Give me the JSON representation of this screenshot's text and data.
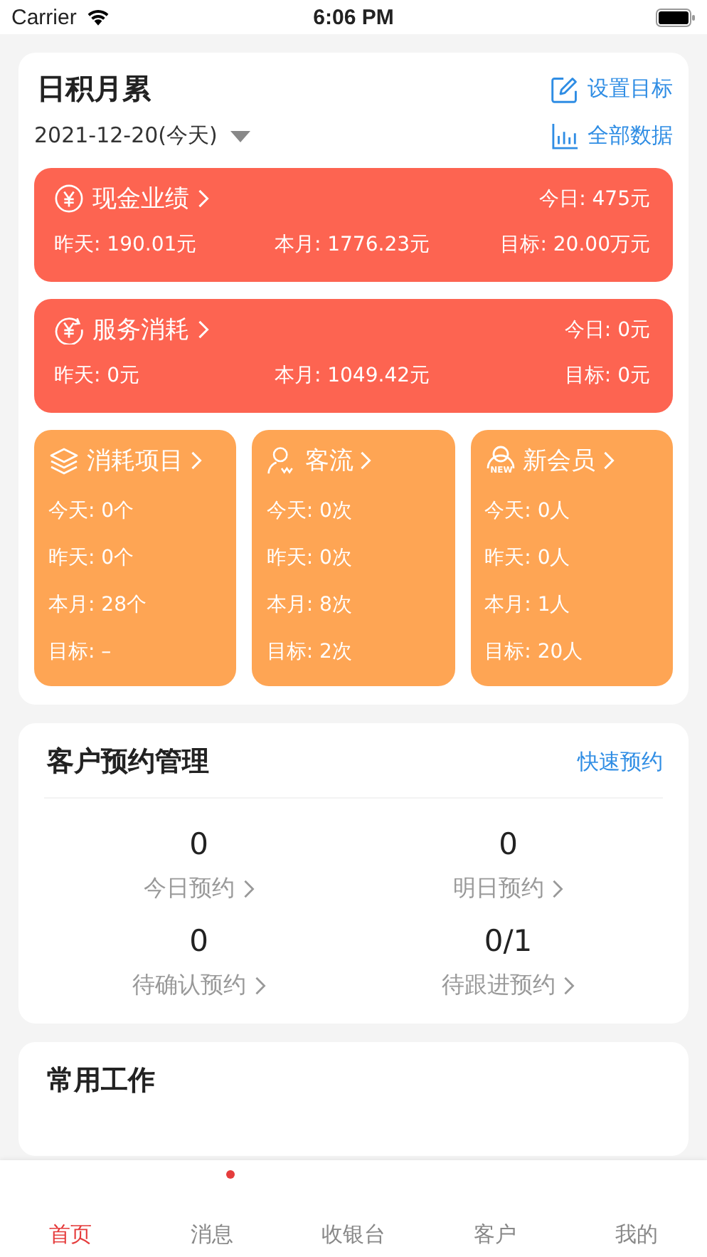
{
  "status_bar": {
    "carrier": "Carrier",
    "time": "6:06 PM"
  },
  "summary": {
    "title": "日积月累",
    "set_goal": "设置目标",
    "date": "2021-12-20(今天)",
    "all_data": "全部数据",
    "money_cards": [
      {
        "title": "现金业绩",
        "today": "今日: 475元",
        "yesterday": "昨天: 190.01元",
        "month": "本月: 1776.23元",
        "target": "目标: 20.00万元"
      },
      {
        "title": "服务消耗",
        "today": "今日: 0元",
        "yesterday": "昨天: 0元",
        "month": "本月: 1049.42元",
        "target": "目标: 0元"
      }
    ],
    "count_cards": [
      {
        "title": "消耗项目",
        "lines": [
          "今天: 0个",
          "昨天: 0个",
          "本月: 28个",
          "目标: –"
        ]
      },
      {
        "title": "客流",
        "lines": [
          "今天: 0次",
          "昨天: 0次",
          "本月: 8次",
          "目标: 2次"
        ]
      },
      {
        "badge_text": "NEW",
        "title": "新会员",
        "lines": [
          "今天: 0人",
          "昨天: 0人",
          "本月: 1人",
          "目标: 20人"
        ]
      }
    ]
  },
  "appointments": {
    "title": "客户预约管理",
    "quick_book": "快速预约",
    "stats": [
      {
        "value": "0",
        "label": "今日预约"
      },
      {
        "value": "0",
        "label": "明日预约"
      },
      {
        "value": "0",
        "label": "待确认预约"
      },
      {
        "value": "0/1",
        "label": "待跟进预约"
      }
    ]
  },
  "common_work": {
    "title": "常用工作"
  },
  "tab_bar": [
    {
      "label": "首页",
      "selected": true,
      "badge": false
    },
    {
      "label": "消息",
      "selected": false,
      "badge": true
    },
    {
      "label": "收银台",
      "selected": false,
      "badge": false
    },
    {
      "label": "客户",
      "selected": false,
      "badge": false
    },
    {
      "label": "我的",
      "selected": false,
      "badge": false
    }
  ]
}
